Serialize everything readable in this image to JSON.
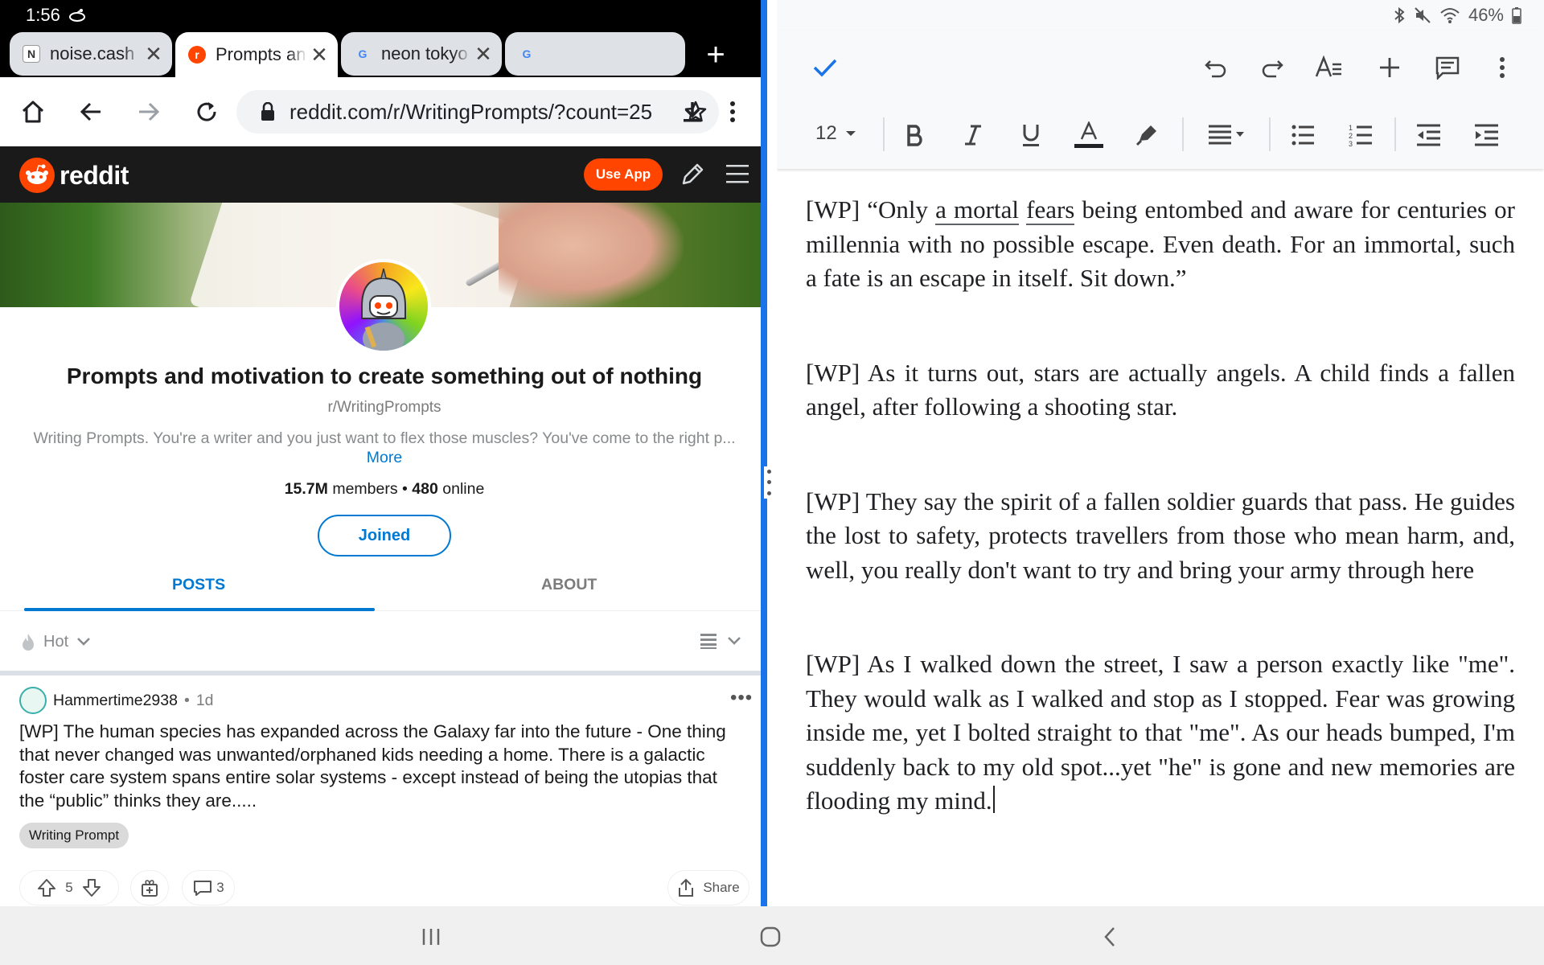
{
  "status_left": {
    "time": "1:56"
  },
  "status_right": {
    "battery": "46%"
  },
  "browser": {
    "tabs": [
      {
        "title": "noise.cash",
        "favicon": "N"
      },
      {
        "title": "Prompts and motivation",
        "favicon": "r"
      },
      {
        "title": "neon tokyo wallpaper",
        "favicon": "G"
      },
      {
        "title": "",
        "favicon": "G"
      }
    ],
    "new_tab": "+",
    "url": "reddit.com/r/WritingPrompts/?count=25"
  },
  "reddit": {
    "logo_text": "reddit",
    "use_app": "Use App",
    "subreddit_title": "Prompts and motivation to create something out of nothing",
    "subreddit_name": "r/WritingPrompts",
    "description": "Writing Prompts. You're a writer and you just want to flex those muscles? You've come to the right p...",
    "more": "More",
    "members_count": "15.7M",
    "members_label": "members",
    "online_count": "480",
    "online_label": "online",
    "joined": "Joined",
    "tabs": {
      "posts": "POSTS",
      "about": "ABOUT"
    },
    "sort": "Hot",
    "post": {
      "author": "Hammertime2938",
      "age": "1d",
      "title": "[WP] The human species has expanded across the Galaxy far into the future - One thing that never changed was unwanted/orphaned kids needing a home. There is a galactic foster care system spans entire solar systems - except instead of being the utopias that the “public” thinks they are.....",
      "flair": "Writing Prompt",
      "votes": "5",
      "comments": "3",
      "share": "Share"
    }
  },
  "doc": {
    "font_size": "12",
    "p1_a": "[WP] “Only ",
    "p1_u1": "a mortal",
    "p1_b": " ",
    "p1_u2": "fears",
    "p1_c": " being entombed and aware for centuries or millennia with no possible escape. Even death. For an immortal, such a fate is an escape in itself. Sit down.”",
    "p2": "[WP] As it turns out, stars are actually angels. A child finds a fallen angel, after following a shooting star.",
    "p3": "[WP] They say the spirit of a fallen soldier guards that pass. He guides the lost to safety, protects travellers from those who mean harm, and, well, you really don't want to try and bring your army through here",
    "p4": "[WP] As I walked down the street, I saw a person exactly like \"me\". They would walk as I walked and stop as I stopped. Fear was growing inside me, yet I bolted straight to that \"me\". As our heads bumped, I'm suddenly back to my old spot...yet \"he\" is gone and new memories are flooding my mind."
  },
  "colors": {
    "reddit_orange": "#ff4500",
    "reddit_blue": "#0079d3",
    "split_divider": "#1a73e8"
  }
}
